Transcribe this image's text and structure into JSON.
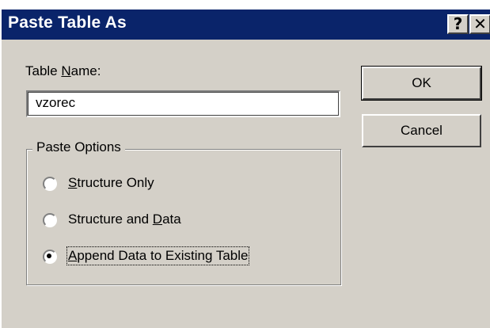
{
  "window": {
    "title": "Paste Table As",
    "help_glyph": "?",
    "close_glyph": "✕"
  },
  "table_name": {
    "label_pre": "Table ",
    "label_key": "N",
    "label_post": "ame:",
    "value": "vzorec"
  },
  "buttons": {
    "ok_label": "OK",
    "cancel_label": "Cancel"
  },
  "paste_options": {
    "legend": "Paste Options",
    "selected": "append_data",
    "options": [
      {
        "id": "structure_only",
        "pre": "",
        "key": "S",
        "post": "tructure Only"
      },
      {
        "id": "structure_and_data",
        "pre": "Structure and ",
        "key": "D",
        "post": "ata"
      },
      {
        "id": "append_data",
        "pre": "",
        "key": "A",
        "post": "ppend Data to Existing Table"
      }
    ]
  },
  "colors": {
    "titlebar": "#0a246a",
    "face": "#d4d0c8"
  }
}
